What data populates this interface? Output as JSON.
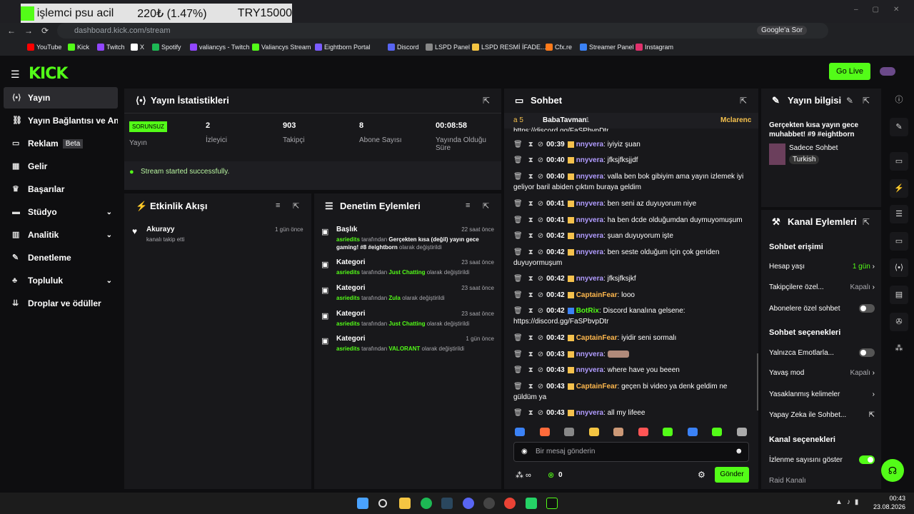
{
  "overlay": {
    "text1": "işlemci psu acil",
    "text2": "220₺ (1.47%)",
    "text3": "TRY15000"
  },
  "browser": {
    "url": "dashboard.kick.com/stream",
    "google": "Google'a Sor"
  },
  "bookmarks": [
    "YouTube",
    "Kick",
    "Twitch",
    "X",
    "Spotify",
    "valiancys - Twitch",
    "Valiancys Stream",
    "Eightborn Portal",
    "Discord",
    "LSPD Panel",
    "LSPD  RESMİ İFADE...",
    "Cfx.re",
    "Streamer Panel",
    "Instagram"
  ],
  "header": {
    "logo": "KICK",
    "golive": "Go Live"
  },
  "sidebar": [
    "Yayın",
    "Yayın Bağlantısı ve Anahtar",
    "Reklam",
    "Gelir",
    "Başarılar",
    "Stüdyo",
    "Analitik",
    "Denetleme",
    "Topluluk",
    "Droplar ve ödüller"
  ],
  "beta": "Beta",
  "stats": {
    "title": "Yayın İstatistikleri",
    "status": "SORUNSUZ",
    "status_label": "Yayın",
    "viewers": "2",
    "viewers_label": "İzleyici",
    "followers": "903",
    "followers_label": "Takipçi",
    "subs": "8",
    "subs_label": "Abone Sayısı",
    "uptime": "00:08:58",
    "uptime_label": "Yayında Olduğu Süre",
    "success": "Stream started successfully."
  },
  "activity": {
    "title": "Etkinlik Akışı",
    "user": "Akurayy",
    "action": "kanalı takip etti",
    "time": "1 gün önce"
  },
  "moderation": {
    "title": "Denetim Eylemleri",
    "items": [
      {
        "type": "Başlık",
        "time": "22 saat önce",
        "user": "asriedits",
        "pre": "tarafından",
        "val": "Gerçekten kısa (değil) yayın gece gaming! #8 #eightborn",
        "post": "olarak değiştirildi"
      },
      {
        "type": "Kategori",
        "time": "23 saat önce",
        "user": "asriedits",
        "pre": "tarafından",
        "val": "Just Chatting",
        "post": "olarak değiştirildi"
      },
      {
        "type": "Kategori",
        "time": "23 saat önce",
        "user": "asriedits",
        "pre": "tarafından",
        "val": "Zula",
        "post": "olarak değiştirildi"
      },
      {
        "type": "Kategori",
        "time": "23 saat önce",
        "user": "asriedits",
        "pre": "tarafından",
        "val": "Just Chatting",
        "post": "olarak değiştirildi"
      },
      {
        "type": "Kategori",
        "time": "1 gün önce",
        "user": "asriedits",
        "pre": "tarafından",
        "val": "VALORANT",
        "post": "olarak değiştirildi"
      }
    ]
  },
  "chat": {
    "title": "Sohbet",
    "pinned_user": "BabaTavman",
    "pinned_count": "1",
    "pinned_left": "a 5",
    "pinned_right": "Mclarenc",
    "top_link": "https://discord.gg/FaSPbvpDtr",
    "lines": [
      {
        "time": "00:39",
        "user": "nnyvera",
        "msg": "iyiyiz şuan"
      },
      {
        "time": "00:40",
        "user": "nnyvera",
        "msg": "jfksjfksjjdf"
      },
      {
        "time": "00:40",
        "user": "nnyvera",
        "msg": "valla ben bok gibiyim ama yayın izlemek iyi geliyor baril abiden çıktım buraya geldim"
      },
      {
        "time": "00:41",
        "user": "nnyvera",
        "msg": "ben seni az duyuyorum niye"
      },
      {
        "time": "00:41",
        "user": "nnyvera",
        "msg": "ha ben dcde olduğumdan duymuyomuşum"
      },
      {
        "time": "00:42",
        "user": "nnyvera",
        "msg": "şuan duyuyorum işte"
      },
      {
        "time": "00:42",
        "user": "nnyvera",
        "msg": "ben seste olduğum için çok geriden duyuyormuşum"
      },
      {
        "time": "00:42",
        "user": "nnyvera",
        "msg": "jfksjfksjkf"
      },
      {
        "time": "00:42",
        "user": "CaptainFear",
        "msg": "looo"
      },
      {
        "time": "00:42",
        "user": "BotRix",
        "msg": "Discord kanalına gelsene: https://discord.gg/FaSPbvpDtr"
      },
      {
        "time": "00:42",
        "user": "CaptainFear",
        "msg": "iyidir seni sormalı"
      },
      {
        "time": "00:43",
        "user": "nnyvera",
        "msg": ""
      },
      {
        "time": "00:43",
        "user": "nnyvera",
        "msg": "where have you beeen"
      },
      {
        "time": "00:43",
        "user": "CaptainFear",
        "msg": "geçen bi video ya denk geldim ne güldüm ya"
      },
      {
        "time": "00:43",
        "user": "nnyvera",
        "msg": "all my lifeee"
      }
    ],
    "placeholder": "Bir mesaj gönderin",
    "points": "0",
    "send": "Gönder"
  },
  "info": {
    "title": "Yayın bilgisi",
    "stream_title": "Gerçekten kısa yayın gece muhabbet! #9 #eightborn",
    "category": "Sadece Sohbet",
    "lang": "Turkish"
  },
  "channel": {
    "title": "Kanal Eylemleri",
    "chat_access": "Sohbet erişimi",
    "acc_age": "Hesap yaşı",
    "acc_age_val": "1 gün",
    "followers_only": "Takipçilere özel...",
    "followers_only_val": "Kapalı",
    "subs_only": "Abonelere özel sohbet",
    "chat_opts": "Sohbet seçenekleri",
    "emote_only": "Yalnızca Emotlarla...",
    "slow": "Yavaş mod",
    "slow_val": "Kapalı",
    "banned": "Yasaklanmış kelimeler",
    "ai": "Yapay Zeka ile Sohbet...",
    "channel_opts": "Kanal seçenekleri",
    "views": "İzlenme sayısını göster",
    "raid": "Raid Kanalı"
  },
  "clock": {
    "time": "00:43",
    "date": "23.08.2026"
  },
  "colors": {
    "accent": "#53fc18",
    "panel": "#18181b",
    "bg": "#0e0e10"
  }
}
